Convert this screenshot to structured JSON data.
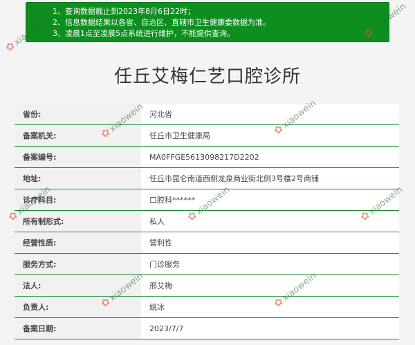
{
  "notice": {
    "lines": [
      "1、查询数据截止到2023年8月6日22时；",
      "2、信息数据结果以各省、自治区、直辖市卫生健康委数据为准。",
      "3、凌晨1点至凌晨5点系统进行维护，不能提供查询。"
    ]
  },
  "page": {
    "title": "任丘艾梅仁艺口腔诊所"
  },
  "records": [
    {
      "label": "省份:",
      "value": "河北省"
    },
    {
      "label": "备案机关:",
      "value": "任丘市卫生健康局"
    },
    {
      "label": "备案编号:",
      "value": "MA0FFGE5613098217D2202"
    },
    {
      "label": "地址:",
      "value": "任丘市昆仑南道西侧龙泉商业街北侧3号楼2号商铺"
    },
    {
      "label": "诊疗科目:",
      "value": "口腔科******"
    },
    {
      "label": "所有制形式:",
      "value": "私人"
    },
    {
      "label": "经营性质:",
      "value": "营利性"
    },
    {
      "label": "服务方式:",
      "value": "门诊服务"
    },
    {
      "label": "法人:",
      "value": "邢艾梅"
    },
    {
      "label": "负责人:",
      "value": "姚冰"
    },
    {
      "label": "备案日期:",
      "value": "2023/7/7"
    }
  ],
  "watermark": {
    "text": "xiaowein"
  }
}
